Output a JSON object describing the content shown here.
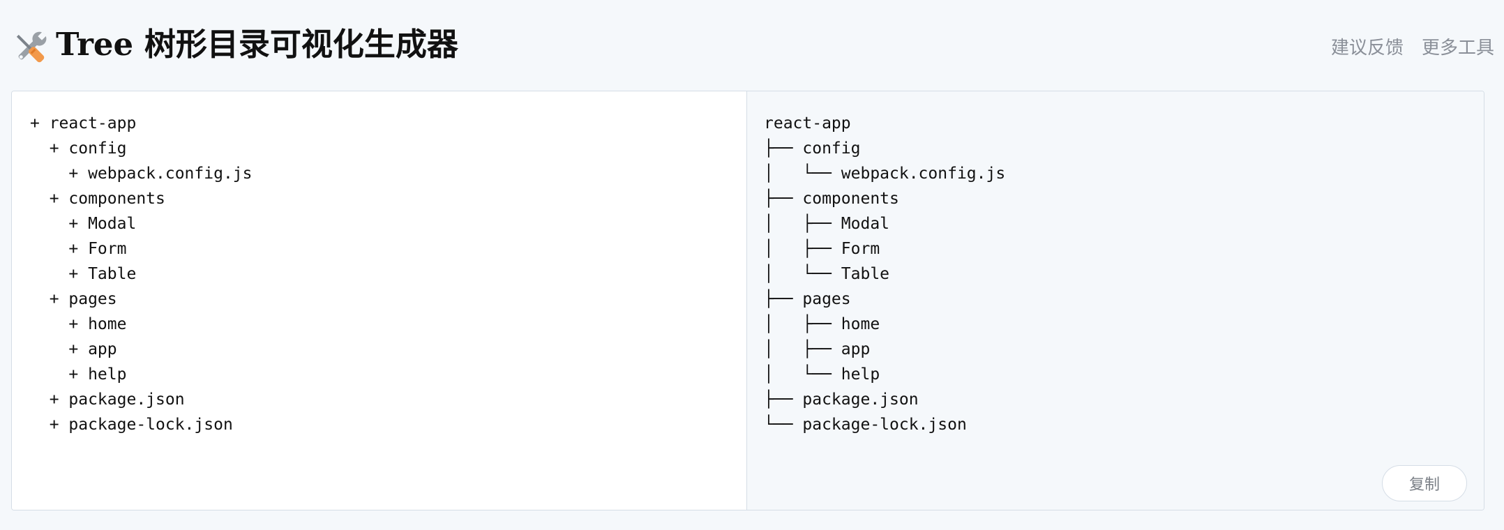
{
  "header": {
    "title": "Tree 树形目录可视化生成器",
    "logo_icon": "tools-icon",
    "nav": [
      {
        "label": "建议反馈"
      },
      {
        "label": "更多工具"
      }
    ]
  },
  "editor": {
    "value": "+ react-app\n  + config\n    + webpack.config.js\n  + components\n    + Modal\n    + Form\n    + Table\n  + pages\n    + home\n    + app\n    + help\n  + package.json\n  + package-lock.json"
  },
  "output": {
    "tree_text": "react-app\n├── config\n│   └── webpack.config.js\n├── components\n│   ├── Modal\n│   ├── Form\n│   └── Table\n├── pages\n│   ├── home\n│   ├── app\n│   └── help\n├── package.json\n└── package-lock.json",
    "copy_label": "复制"
  },
  "colors": {
    "background": "#f5f8fb",
    "border": "#d5dde6",
    "nav_text": "#8a8f98",
    "wrench": "#9aa0a6",
    "screwdriver_handle": "#f2994a"
  }
}
